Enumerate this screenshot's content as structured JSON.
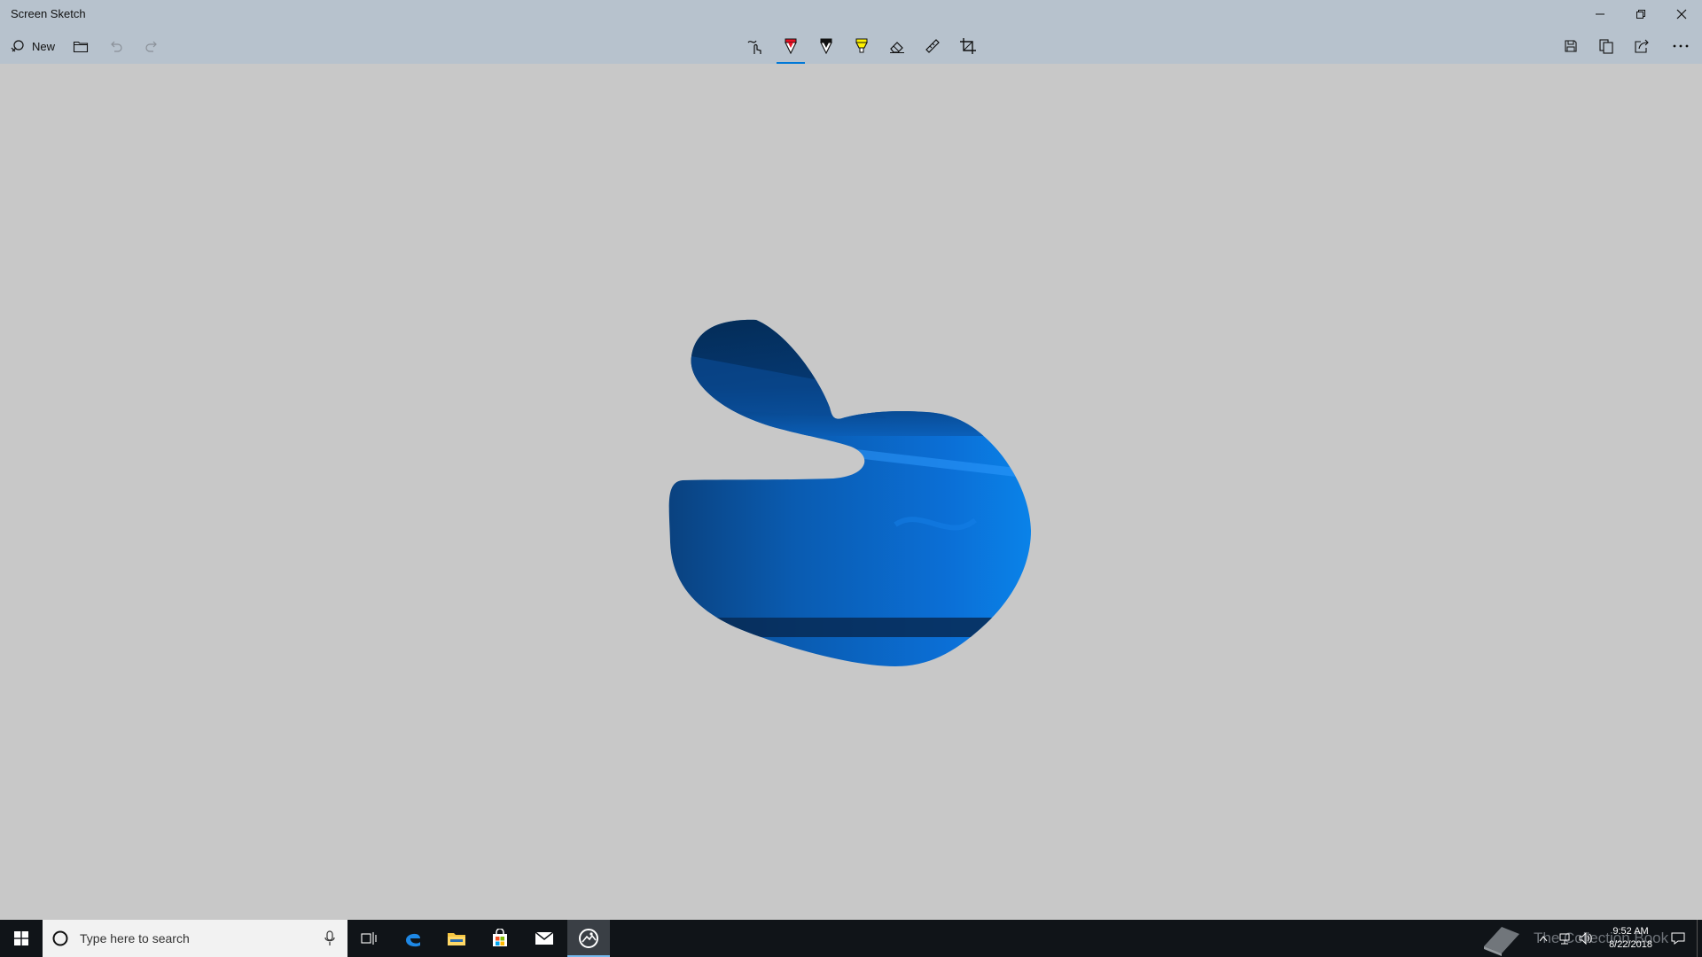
{
  "window": {
    "title": "Screen Sketch"
  },
  "toolbar": {
    "new_label": "New",
    "icons": {
      "new": "new-snip-icon",
      "open": "folder-icon",
      "undo": "undo-icon",
      "redo": "redo-icon",
      "touch": "touch-writing-icon",
      "ballpoint": "ballpoint-pen-icon",
      "pencil": "pencil-icon",
      "highlighter": "highlighter-icon",
      "eraser": "eraser-icon",
      "ruler": "ruler-icon",
      "crop": "crop-icon",
      "save": "save-icon",
      "copy": "copy-icon",
      "share": "share-icon",
      "more": "more-icon"
    },
    "selected_tool": "ballpoint-pen",
    "colors": {
      "ballpoint": "#e81123",
      "pencil": "#111111",
      "highlighter": "#fff100",
      "accent": "#0078d7"
    }
  },
  "taskbar": {
    "search_placeholder": "Type here to search",
    "clock_time": "9:52 AM",
    "clock_date": "8/22/2018",
    "watermark": "The Collection Book"
  }
}
